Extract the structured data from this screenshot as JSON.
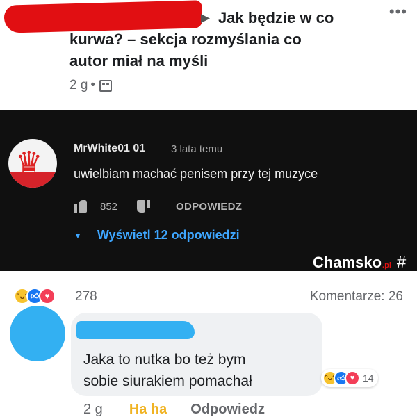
{
  "post": {
    "title": "Jak będzie w co kurwa? – sekcja rozmyślania co autor miał na myśli",
    "title_line1": "Jak będzie w co",
    "title_line2": "kurwa? – sekcja rozmyślania co",
    "title_line3": "autor miał na myśli",
    "time": "2 g",
    "separator": "•",
    "privacy_icon": "group-privacy-icon",
    "more_icon": "•••"
  },
  "youtube_comment": {
    "author": "MrWhite01 01",
    "time": "3 lata temu",
    "text": "uwielbiam machać penisem przy tej muzyce",
    "likes": "852",
    "reply_label": "ODPOWIEDZ",
    "view_replies": "Wyświetl 12 odpowiedzi",
    "avatar_icon": "eagle-emblem-icon"
  },
  "watermark": {
    "brand": "Chamsko",
    "tld": ".pl",
    "symbol": "#"
  },
  "reactions": {
    "count": "278",
    "comments_label": "Komentarze: 26",
    "icons": [
      "haha",
      "like",
      "love"
    ]
  },
  "comment": {
    "text_line1": "Jaka to nutka bo też bym",
    "text_line2": "sobie siurakiem pomachał",
    "reaction_count": "14",
    "time": "2 g",
    "haha_label": "Ha ha",
    "reply_label": "Odpowiedz"
  },
  "colors": {
    "redaction_red": "#e10f12",
    "redaction_blue": "#33b0f2",
    "youtube_bg": "#101010",
    "link_blue": "#3ea6ff",
    "haha_yellow": "#f0b323"
  }
}
